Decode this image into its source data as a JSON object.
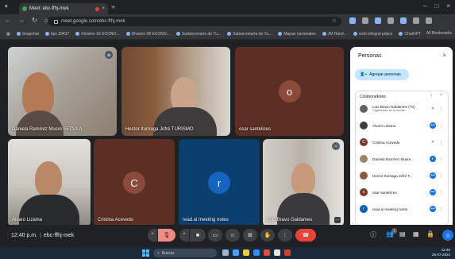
{
  "browser": {
    "tab_title": "Meet: ebc-ffhj-mek",
    "tab_close": "×",
    "new_tab": "+",
    "url": "meet.google.com/ebc-ffhj-mek",
    "window_controls": [
      "–",
      "□",
      "×"
    ],
    "bookmarks": [
      "Snapchat",
      "bps 39437",
      "Division 16 ECONO...",
      "Division 38 ECONO...",
      "Subsecretaría de Tu...",
      "Subsecretaría de Tu...",
      "Mapas nacionales",
      "JM Hand...",
      "ciclo integral pdpcs",
      "ChatGPT"
    ],
    "all_bookmarks": "All Bookmarks"
  },
  "tiles": [
    {
      "name": "Daniela Ramírez Musre SECPLA",
      "type": "camera"
    },
    {
      "name": "Hector Iturriaga Jofré TURISMO",
      "type": "camera"
    },
    {
      "name": "osar santelices",
      "type": "avatar",
      "letter": "o",
      "bg": "#7a3a2b"
    },
    {
      "name": "Álvaro Lizama",
      "type": "camera"
    },
    {
      "name": "Cristina Acevedo",
      "type": "avatar",
      "letter": "C",
      "bg": "#7a3a2b"
    },
    {
      "name": "read.ai meeting notes",
      "type": "avatar",
      "letter": "r",
      "bg": "#0b5eaf"
    },
    {
      "name": "Luis Bravo Galdames",
      "type": "camera"
    }
  ],
  "panel": {
    "title": "Personas",
    "close": "×",
    "add_label": "Agregar personas",
    "section": "Colaboradores",
    "participants": [
      {
        "name": "Luis Bravo Galdames (Tú)",
        "sub": "Organizador de la reunión",
        "avatar": "",
        "color": "#5f6368",
        "mic": "off"
      },
      {
        "name": "Álvaro Lizama",
        "sub": "",
        "avatar": "",
        "color": "#3c4043",
        "mic": "on"
      },
      {
        "name": "Cristina Acevedo",
        "sub": "",
        "avatar": "C",
        "color": "#7a3a2b",
        "mic": "off"
      },
      {
        "name": "Daniela Ramírez Musre...",
        "sub": "",
        "avatar": "",
        "color": "#a0856b",
        "mic": "on"
      },
      {
        "name": "Hector Iturriaga Jofré T...",
        "sub": "",
        "avatar": "",
        "color": "#8a5b3c",
        "mic": "on"
      },
      {
        "name": "osar santelices",
        "sub": "",
        "avatar": "o",
        "color": "#7a3a2b",
        "mic": "on"
      },
      {
        "name": "read.ai meeting notes",
        "sub": "",
        "avatar": "r",
        "color": "#0b5eaf",
        "mic": "on"
      }
    ]
  },
  "controls": {
    "time": "12:40 p.m.",
    "meeting_code": "ebc-ffhj-mek",
    "people_count": "7"
  },
  "taskbar": {
    "search_placeholder": "Buscar",
    "time": "12:40",
    "date": "25-07-2024"
  }
}
